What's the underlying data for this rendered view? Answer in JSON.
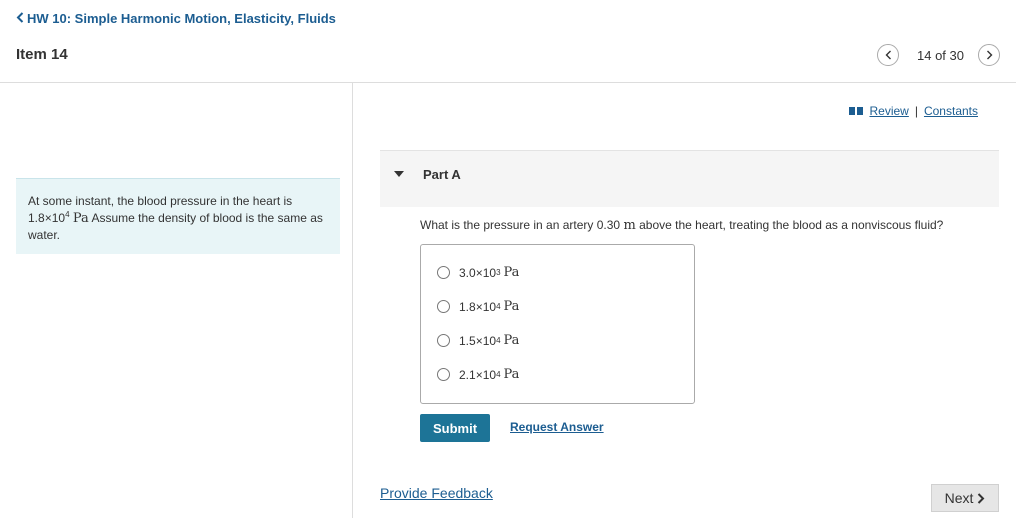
{
  "header": {
    "back_link": "HW 10: Simple Harmonic Motion, Elasticity, Fluids",
    "item_title": "Item 14",
    "pager_text": "14 of 30"
  },
  "links": {
    "review": "Review",
    "separator": "|",
    "constants": "Constants"
  },
  "problem": {
    "text_before": "At some instant, the blood pressure in the heart is",
    "mantissa": "1.8",
    "times": "×",
    "base": "10",
    "exponent": "4",
    "unit": "Pa",
    "text_after": "Assume the density of blood is the same as water."
  },
  "part": {
    "label": "Part A",
    "question_before": "What is the pressure in an artery 0.30",
    "question_unit": "m",
    "question_after": "above the heart, treating the blood as a nonviscous fluid?"
  },
  "choices": [
    {
      "mantissa": "3.0",
      "times": "×",
      "base": "10",
      "exponent": "3",
      "unit": "Pa"
    },
    {
      "mantissa": "1.8",
      "times": "×",
      "base": "10",
      "exponent": "4",
      "unit": "Pa"
    },
    {
      "mantissa": "1.5",
      "times": "×",
      "base": "10",
      "exponent": "4",
      "unit": "Pa"
    },
    {
      "mantissa": "2.1",
      "times": "×",
      "base": "10",
      "exponent": "4",
      "unit": "Pa"
    }
  ],
  "actions": {
    "submit": "Submit",
    "request_answer": "Request Answer",
    "provide_feedback": "Provide Feedback",
    "next": "Next"
  },
  "icons": {
    "back": "chevron-left-icon",
    "prev": "chevron-left-icon",
    "next_page": "chevron-right-icon",
    "review": "book-icon",
    "collapse": "caret-down-icon",
    "next_button": "chevron-right-icon"
  },
  "colors": {
    "link": "#1c5d91",
    "submit_bg": "#1d7497",
    "problem_bg": "#e8f5f7"
  }
}
